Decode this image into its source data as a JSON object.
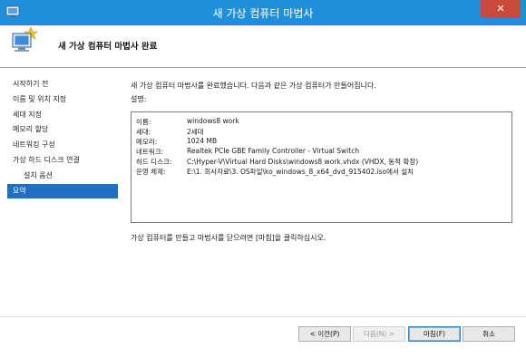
{
  "window": {
    "title": "새 가상 컴퓨터 마법사",
    "close_glyph": "✕"
  },
  "header": {
    "heading": "새 가상 컴퓨터 마법사 완료",
    "icon": "wizard-computer-star-icon"
  },
  "nav": {
    "items": [
      {
        "label": "시작하기 전",
        "sub": false,
        "active": false
      },
      {
        "label": "이름 및 위치 지정",
        "sub": false,
        "active": false
      },
      {
        "label": "세대 지정",
        "sub": false,
        "active": false
      },
      {
        "label": "메모리 할당",
        "sub": false,
        "active": false
      },
      {
        "label": "네트워킹 구성",
        "sub": false,
        "active": false
      },
      {
        "label": "가상 하드 디스크 연결",
        "sub": false,
        "active": false
      },
      {
        "label": "설치 옵션",
        "sub": true,
        "active": false
      },
      {
        "label": "요약",
        "sub": false,
        "active": true
      }
    ]
  },
  "content": {
    "intro": "새 가상 컴퓨터 마법사를 완료했습니다. 다음과 같은 가상 컴퓨터가 만들어집니다.",
    "desc_label": "설명:",
    "summary": [
      {
        "key": "이름:",
        "value": "windows8 work"
      },
      {
        "key": "세대:",
        "value": "2세대"
      },
      {
        "key": "메모리:",
        "value": "1024 MB"
      },
      {
        "key": "네트워크:",
        "value": "Realtek PCIe GBE Family Controller - Virtual Switch"
      },
      {
        "key": "하드 디스크:",
        "value": "C:\\Hyper-V\\Virtual Hard Disks\\windows8 work.vhdx (VHDX, 동적 확장)"
      },
      {
        "key": "운영 체제:",
        "value": "E:\\1. 회사자료\\3. OS파일\\ko_windows_8_x64_dvd_915402.iso에서 설치"
      }
    ],
    "footer": "가상 컴퓨터를 만들고 마법사를 닫으려면 [마침]을 클릭하십시오."
  },
  "buttons": {
    "prev": "< 이전(P)",
    "next": "다음(N) >",
    "finish": "마침(F)",
    "cancel": "취소"
  }
}
